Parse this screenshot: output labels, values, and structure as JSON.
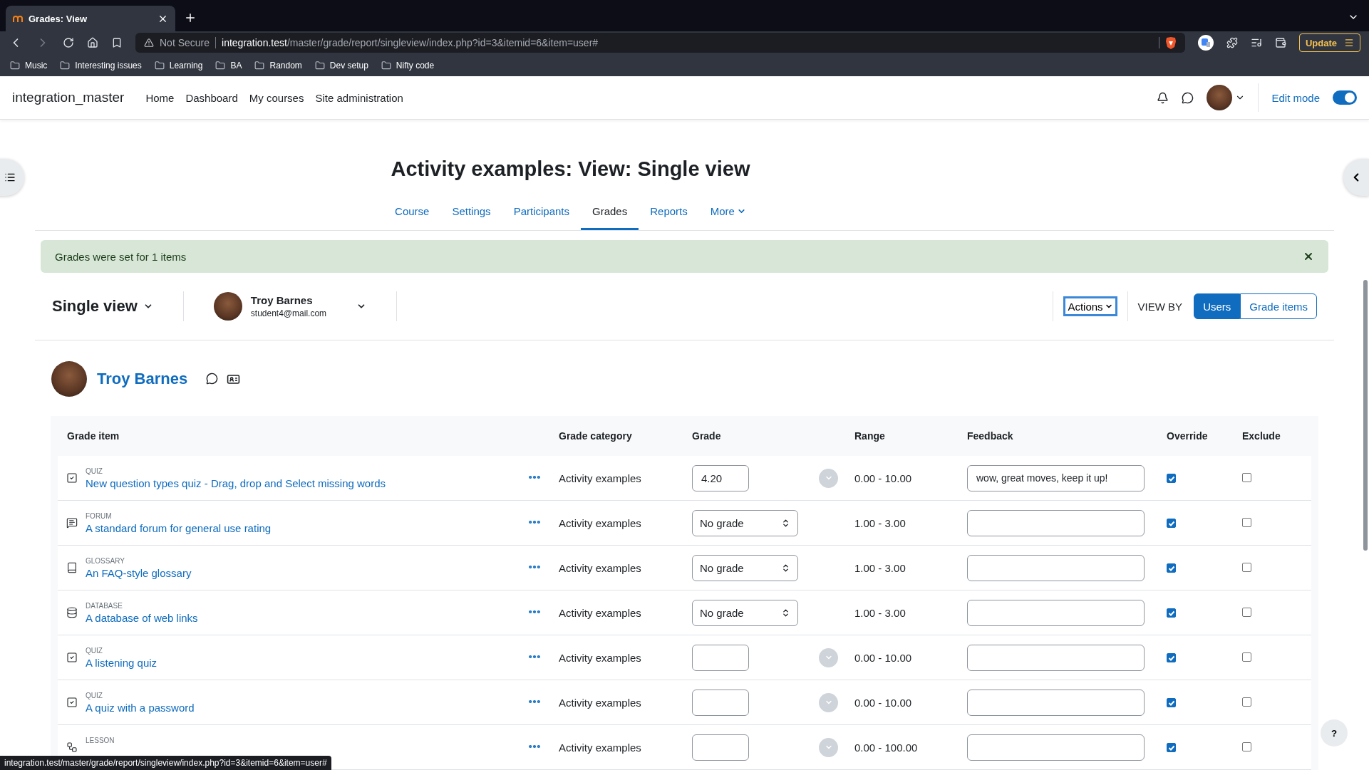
{
  "browser": {
    "tab_title": "Grades: View",
    "address": {
      "warning": "Not Secure",
      "host": "integration.test",
      "path": "/master/grade/report/singleview/index.php?id=3&itemid=6&item=user#"
    },
    "bookmarks": [
      "Music",
      "Interesting issues",
      "Learning",
      "BA",
      "Random",
      "Dev setup",
      "Nifty code"
    ],
    "update_button": "Update"
  },
  "site": {
    "name": "integration_master",
    "nav": [
      "Home",
      "Dashboard",
      "My courses",
      "Site administration"
    ],
    "edit_mode": {
      "label": "Edit mode",
      "on": true
    }
  },
  "page_title": "Activity examples: View: Single view",
  "course_tabs": [
    {
      "label": "Course",
      "selected": false
    },
    {
      "label": "Settings",
      "selected": false
    },
    {
      "label": "Participants",
      "selected": false
    },
    {
      "label": "Grades",
      "selected": true
    },
    {
      "label": "Reports",
      "selected": false
    },
    {
      "label": "More",
      "selected": false,
      "kind": "menu"
    }
  ],
  "alert": "Grades were set for 1 items",
  "report_bar": {
    "report": "Single view",
    "user": {
      "name": "Troy Barnes",
      "email": "student4@mail.com"
    },
    "actions": "Actions",
    "view_by": "VIEW BY",
    "view_options": [
      {
        "label": "Users",
        "selected": true
      },
      {
        "label": "Grade items",
        "selected": false
      }
    ]
  },
  "user_heading": "Troy Barnes",
  "table": {
    "columns": [
      "Grade item",
      "Grade category",
      "Grade",
      "Range",
      "Feedback",
      "Override",
      "Exclude"
    ],
    "rows": [
      {
        "type": "QUIZ",
        "kind": "quiz",
        "name": "New question types quiz - Drag, drop and Select missing words",
        "category": "Activity examples",
        "grade": {
          "kind": "input",
          "value": "4.20"
        },
        "range": "0.00 - 10.00",
        "feedback": "wow, great moves, keep it up!",
        "override": true,
        "exclude": false
      },
      {
        "type": "FORUM",
        "kind": "forum",
        "name": "A standard forum for general use rating",
        "category": "Activity examples",
        "grade": {
          "kind": "select",
          "value": "No grade"
        },
        "range": "1.00 - 3.00",
        "override": true,
        "exclude": false
      },
      {
        "type": "GLOSSARY",
        "kind": "glossary",
        "name": "An FAQ-style glossary",
        "category": "Activity examples",
        "grade": {
          "kind": "select",
          "value": "No grade"
        },
        "range": "1.00 - 3.00",
        "override": true,
        "exclude": false
      },
      {
        "type": "DATABASE",
        "kind": "database",
        "name": "A database of web links",
        "category": "Activity examples",
        "grade": {
          "kind": "select",
          "value": "No grade"
        },
        "range": "1.00 - 3.00",
        "override": true,
        "exclude": false
      },
      {
        "type": "QUIZ",
        "kind": "quiz",
        "name": "A listening quiz",
        "category": "Activity examples",
        "grade": {
          "kind": "input"
        },
        "range": "0.00 - 10.00",
        "override": true,
        "exclude": false
      },
      {
        "type": "QUIZ",
        "kind": "quiz",
        "name": "A quiz with a password",
        "category": "Activity examples",
        "grade": {
          "kind": "input"
        },
        "range": "0.00 - 10.00",
        "override": true,
        "exclude": false
      },
      {
        "type": "LESSON",
        "kind": "lesson",
        "category": "Activity examples",
        "grade": {
          "kind": "input"
        },
        "range": "0.00 - 100.00",
        "override": true,
        "exclude": false
      }
    ]
  },
  "help_button": "?",
  "status_bar": "integration.test/master/grade/report/singleview/index.php?id=3&itemid=6&item=user#"
}
